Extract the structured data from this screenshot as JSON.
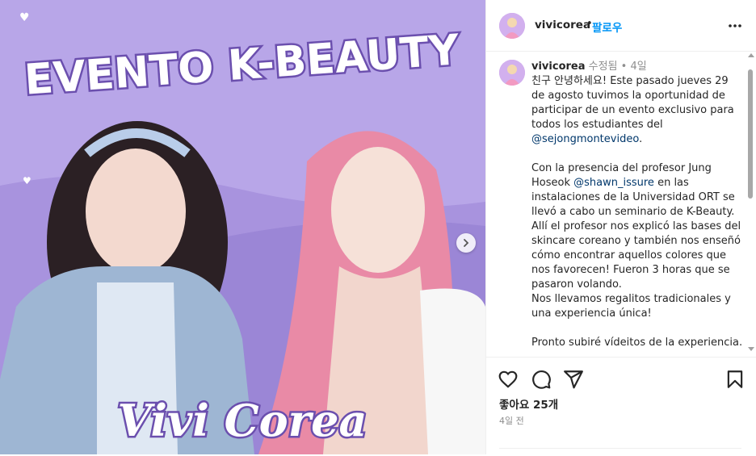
{
  "image": {
    "title": "EVENTO K-BEAUTY",
    "subtitle": "Vivi Corea",
    "next_icon": "chevron-right-icon"
  },
  "header": {
    "username": "vivicorea",
    "separator": "•",
    "follow_label": "팔로우",
    "more_icon": "more-horizontal-icon"
  },
  "caption": {
    "username": "vivicorea",
    "edited": "수정됨",
    "dot": "•",
    "age": "4일",
    "lines": [
      {
        "pre": "친구 안녕하세요! Este pasado jueves 29"
      },
      {
        "pre": "de agosto tuvimos la oportunidad de"
      },
      {
        "pre": "participar de un evento exclusivo para"
      },
      {
        "pre": "todos los estudiantes del"
      },
      {
        "mention": "@sejongmontevideo",
        "post": "."
      },
      {
        "pre": ""
      },
      {
        "pre": "Con la presencia del profesor Jung"
      },
      {
        "pre": "Hoseok ",
        "mention": "@shawn_issure",
        "post": " en las"
      },
      {
        "pre": "instalaciones de la Universidad ORT se"
      },
      {
        "pre": "llevó a cabo un seminario de K-Beauty."
      },
      {
        "pre": "Allí el profesor nos explicó las bases del"
      },
      {
        "pre": "skincare coreano y también nos enseñó"
      },
      {
        "pre": "cómo encontrar aquellos colores que"
      },
      {
        "pre": "nos favorecen! Fueron 3 horas que se"
      },
      {
        "pre": "pasaron volando."
      },
      {
        "pre": "Nos llevamos regalitos tradicionales y"
      },
      {
        "pre": "una experiencia única!"
      },
      {
        "pre": ""
      },
      {
        "pre": "Pronto subiré vídeitos de la experiencia."
      }
    ]
  },
  "actions": {
    "like_icon": "heart-icon",
    "comment_icon": "comment-icon",
    "share_icon": "send-icon",
    "save_icon": "bookmark-icon",
    "likes_text": "좋아요 25개",
    "date_text": "4일 전"
  },
  "colors": {
    "accent": "#0095f6",
    "mention": "#00376b",
    "image_bg": "#b5a3e6",
    "title_fill": "#ffffff",
    "title_stroke": "#6b4fae"
  }
}
